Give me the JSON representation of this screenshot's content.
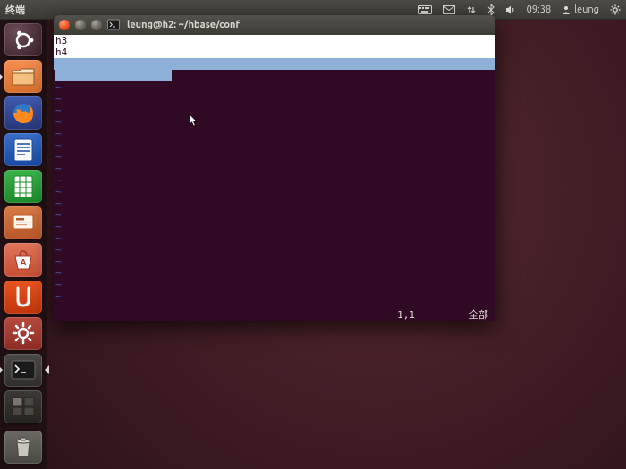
{
  "panel": {
    "app_title": "终端",
    "time": "09:38",
    "username": "leung"
  },
  "launcher": {
    "items": [
      {
        "name": "dash-icon"
      },
      {
        "name": "files-icon"
      },
      {
        "name": "firefox-icon"
      },
      {
        "name": "writer-icon"
      },
      {
        "name": "calc-icon"
      },
      {
        "name": "impress-icon"
      },
      {
        "name": "software-center-icon"
      },
      {
        "name": "ubuntu-one-icon"
      },
      {
        "name": "settings-icon"
      },
      {
        "name": "terminal-icon"
      },
      {
        "name": "workspace-switcher-icon"
      }
    ],
    "trash": {
      "name": "trash-icon"
    }
  },
  "terminal": {
    "title": "leung@h2: ~/hbase/conf",
    "lines": {
      "l1": "h3",
      "l2": "h4"
    },
    "status": {
      "pos": "1,1",
      "rng": "全部"
    },
    "tilde": "~"
  }
}
